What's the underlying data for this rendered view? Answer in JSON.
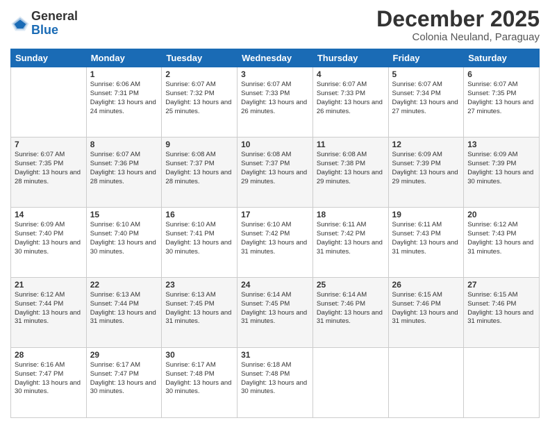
{
  "logo": {
    "general": "General",
    "blue": "Blue"
  },
  "title": "December 2025",
  "subtitle": "Colonia Neuland, Paraguay",
  "days_of_week": [
    "Sunday",
    "Monday",
    "Tuesday",
    "Wednesday",
    "Thursday",
    "Friday",
    "Saturday"
  ],
  "weeks": [
    [
      {
        "day": "",
        "sunrise": "",
        "sunset": "",
        "daylight": ""
      },
      {
        "day": "1",
        "sunrise": "Sunrise: 6:06 AM",
        "sunset": "Sunset: 7:31 PM",
        "daylight": "Daylight: 13 hours and 24 minutes."
      },
      {
        "day": "2",
        "sunrise": "Sunrise: 6:07 AM",
        "sunset": "Sunset: 7:32 PM",
        "daylight": "Daylight: 13 hours and 25 minutes."
      },
      {
        "day": "3",
        "sunrise": "Sunrise: 6:07 AM",
        "sunset": "Sunset: 7:33 PM",
        "daylight": "Daylight: 13 hours and 26 minutes."
      },
      {
        "day": "4",
        "sunrise": "Sunrise: 6:07 AM",
        "sunset": "Sunset: 7:33 PM",
        "daylight": "Daylight: 13 hours and 26 minutes."
      },
      {
        "day": "5",
        "sunrise": "Sunrise: 6:07 AM",
        "sunset": "Sunset: 7:34 PM",
        "daylight": "Daylight: 13 hours and 27 minutes."
      },
      {
        "day": "6",
        "sunrise": "Sunrise: 6:07 AM",
        "sunset": "Sunset: 7:35 PM",
        "daylight": "Daylight: 13 hours and 27 minutes."
      }
    ],
    [
      {
        "day": "7",
        "sunrise": "Sunrise: 6:07 AM",
        "sunset": "Sunset: 7:35 PM",
        "daylight": "Daylight: 13 hours and 28 minutes."
      },
      {
        "day": "8",
        "sunrise": "Sunrise: 6:07 AM",
        "sunset": "Sunset: 7:36 PM",
        "daylight": "Daylight: 13 hours and 28 minutes."
      },
      {
        "day": "9",
        "sunrise": "Sunrise: 6:08 AM",
        "sunset": "Sunset: 7:37 PM",
        "daylight": "Daylight: 13 hours and 28 minutes."
      },
      {
        "day": "10",
        "sunrise": "Sunrise: 6:08 AM",
        "sunset": "Sunset: 7:37 PM",
        "daylight": "Daylight: 13 hours and 29 minutes."
      },
      {
        "day": "11",
        "sunrise": "Sunrise: 6:08 AM",
        "sunset": "Sunset: 7:38 PM",
        "daylight": "Daylight: 13 hours and 29 minutes."
      },
      {
        "day": "12",
        "sunrise": "Sunrise: 6:09 AM",
        "sunset": "Sunset: 7:39 PM",
        "daylight": "Daylight: 13 hours and 29 minutes."
      },
      {
        "day": "13",
        "sunrise": "Sunrise: 6:09 AM",
        "sunset": "Sunset: 7:39 PM",
        "daylight": "Daylight: 13 hours and 30 minutes."
      }
    ],
    [
      {
        "day": "14",
        "sunrise": "Sunrise: 6:09 AM",
        "sunset": "Sunset: 7:40 PM",
        "daylight": "Daylight: 13 hours and 30 minutes."
      },
      {
        "day": "15",
        "sunrise": "Sunrise: 6:10 AM",
        "sunset": "Sunset: 7:40 PM",
        "daylight": "Daylight: 13 hours and 30 minutes."
      },
      {
        "day": "16",
        "sunrise": "Sunrise: 6:10 AM",
        "sunset": "Sunset: 7:41 PM",
        "daylight": "Daylight: 13 hours and 30 minutes."
      },
      {
        "day": "17",
        "sunrise": "Sunrise: 6:10 AM",
        "sunset": "Sunset: 7:42 PM",
        "daylight": "Daylight: 13 hours and 31 minutes."
      },
      {
        "day": "18",
        "sunrise": "Sunrise: 6:11 AM",
        "sunset": "Sunset: 7:42 PM",
        "daylight": "Daylight: 13 hours and 31 minutes."
      },
      {
        "day": "19",
        "sunrise": "Sunrise: 6:11 AM",
        "sunset": "Sunset: 7:43 PM",
        "daylight": "Daylight: 13 hours and 31 minutes."
      },
      {
        "day": "20",
        "sunrise": "Sunrise: 6:12 AM",
        "sunset": "Sunset: 7:43 PM",
        "daylight": "Daylight: 13 hours and 31 minutes."
      }
    ],
    [
      {
        "day": "21",
        "sunrise": "Sunrise: 6:12 AM",
        "sunset": "Sunset: 7:44 PM",
        "daylight": "Daylight: 13 hours and 31 minutes."
      },
      {
        "day": "22",
        "sunrise": "Sunrise: 6:13 AM",
        "sunset": "Sunset: 7:44 PM",
        "daylight": "Daylight: 13 hours and 31 minutes."
      },
      {
        "day": "23",
        "sunrise": "Sunrise: 6:13 AM",
        "sunset": "Sunset: 7:45 PM",
        "daylight": "Daylight: 13 hours and 31 minutes."
      },
      {
        "day": "24",
        "sunrise": "Sunrise: 6:14 AM",
        "sunset": "Sunset: 7:45 PM",
        "daylight": "Daylight: 13 hours and 31 minutes."
      },
      {
        "day": "25",
        "sunrise": "Sunrise: 6:14 AM",
        "sunset": "Sunset: 7:46 PM",
        "daylight": "Daylight: 13 hours and 31 minutes."
      },
      {
        "day": "26",
        "sunrise": "Sunrise: 6:15 AM",
        "sunset": "Sunset: 7:46 PM",
        "daylight": "Daylight: 13 hours and 31 minutes."
      },
      {
        "day": "27",
        "sunrise": "Sunrise: 6:15 AM",
        "sunset": "Sunset: 7:46 PM",
        "daylight": "Daylight: 13 hours and 31 minutes."
      }
    ],
    [
      {
        "day": "28",
        "sunrise": "Sunrise: 6:16 AM",
        "sunset": "Sunset: 7:47 PM",
        "daylight": "Daylight: 13 hours and 30 minutes."
      },
      {
        "day": "29",
        "sunrise": "Sunrise: 6:17 AM",
        "sunset": "Sunset: 7:47 PM",
        "daylight": "Daylight: 13 hours and 30 minutes."
      },
      {
        "day": "30",
        "sunrise": "Sunrise: 6:17 AM",
        "sunset": "Sunset: 7:48 PM",
        "daylight": "Daylight: 13 hours and 30 minutes."
      },
      {
        "day": "31",
        "sunrise": "Sunrise: 6:18 AM",
        "sunset": "Sunset: 7:48 PM",
        "daylight": "Daylight: 13 hours and 30 minutes."
      },
      {
        "day": "",
        "sunrise": "",
        "sunset": "",
        "daylight": ""
      },
      {
        "day": "",
        "sunrise": "",
        "sunset": "",
        "daylight": ""
      },
      {
        "day": "",
        "sunrise": "",
        "sunset": "",
        "daylight": ""
      }
    ]
  ]
}
